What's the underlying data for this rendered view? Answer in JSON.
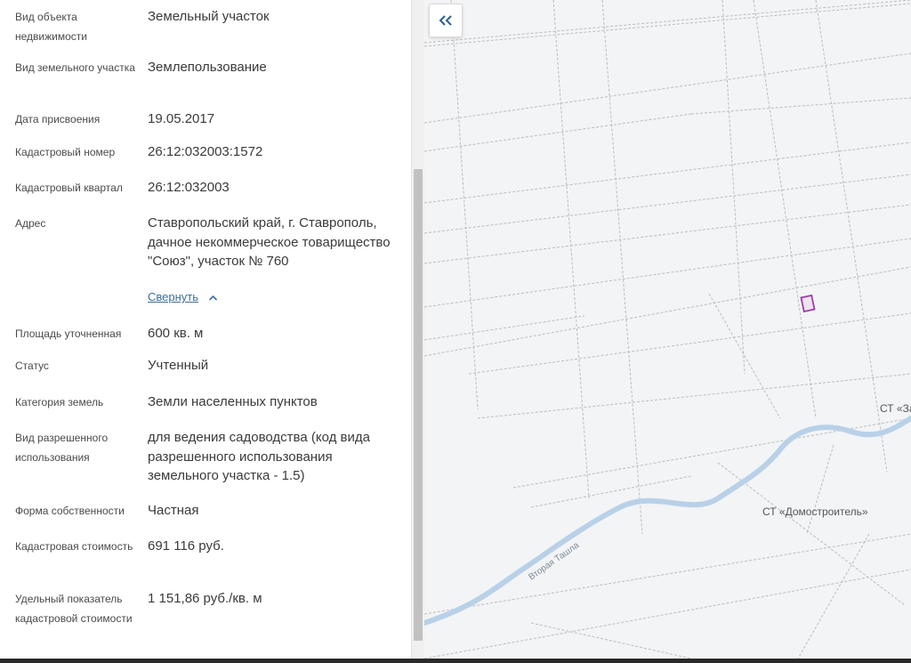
{
  "details": [
    {
      "label": "Вид объекта недвижимости",
      "value": "Земельный участок"
    },
    {
      "label": "Вид земельного участка",
      "value": "Землепользование"
    },
    {
      "label": "Дата присвоения",
      "value": "19.05.2017"
    },
    {
      "label": "Кадастровый номер",
      "value": "26:12:032003:1572"
    },
    {
      "label": "Кадастровый квартал",
      "value": "26:12:032003"
    },
    {
      "label": "Адрес",
      "value": "Ставропольский край, г. Ставрополь, дачное некоммерческое товарищество \"Союз\", участок № 760"
    },
    {
      "label": "Площадь уточненная",
      "value": "600 кв. м"
    },
    {
      "label": "Статус",
      "value": "Учтенный"
    },
    {
      "label": "Категория земель",
      "value": "Земли населенных пунктов"
    },
    {
      "label": "Вид разрешенного использования",
      "value": "для ведения садоводства (код вида разрешенного использования земельного участка - 1.5)"
    },
    {
      "label": "Форма собственности",
      "value": "Частная"
    },
    {
      "label": "Кадастровая стоимость",
      "value": "691 116 руб."
    },
    {
      "label": "Удельный показатель кадастровой стоимости",
      "value": "1 151,86 руб./кв. м"
    }
  ],
  "collapse_label": "Свернуть",
  "map": {
    "label_st_domostroitel": "СТ «Домостроитель»",
    "label_st_partial": "СТ «За",
    "river_label": "Вторая Ташла",
    "parcel_color": "#9b3fa8",
    "river_color": "#b8d1e8"
  },
  "icons": {
    "back": "double-chevron-left-icon",
    "collapse": "chevron-up-icon"
  }
}
